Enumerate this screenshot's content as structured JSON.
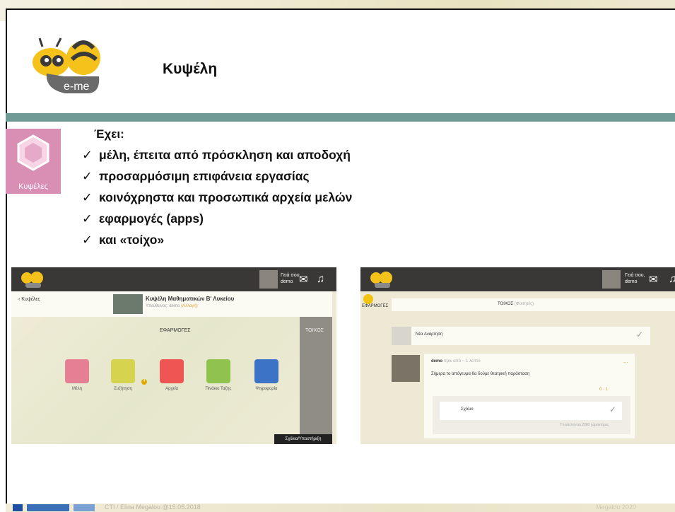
{
  "slide": {
    "title": "Κυψέλη",
    "logo_text": "e-me",
    "tile_label": "Κυψέλες",
    "intro": "Έχει:",
    "check_mark": "✓",
    "bullets": [
      "μέλη, έπειτα από πρόσκληση και αποδοχή",
      "προσαρμόσιμη επιφάνεια εργασίας",
      "κοινόχρηστα και προσωπικά αρχεία μελών",
      "εφαρμογές (apps)",
      "και «τοίχο»"
    ],
    "footer_text": "CTI / Elina Megalou @15.05.2018",
    "footer_right": "Megalou 2020"
  },
  "left_screenshot": {
    "greeting": "Γειά σου,",
    "user": "demo",
    "back_label": "Κυψέλες",
    "hive_title": "Κυψέλη Μαθηματικών Β' Λυκείου",
    "owner_prefix": "Υπεύθυνος:",
    "owner": "demo",
    "owner_suffix": "(Αλλαγή)",
    "apps_header": "ΕΦΑΡΜΟΓΕΣ",
    "wall_header": "ΤΟΙΧΟΣ",
    "apps": [
      {
        "label": "Μέλη",
        "color": "#e57f93",
        "icon": "members-icon"
      },
      {
        "label": "Συζήτηση",
        "color": "#d6d34e",
        "icon": "chat-icon"
      },
      {
        "label": "Αρχεία",
        "color": "#ef5552",
        "icon": "folder-icon"
      },
      {
        "label": "Πινάκιο Ταξης",
        "color": "#8fc34d",
        "icon": "board-icon"
      },
      {
        "label": "Ψηφοφορία",
        "color": "#3d73c7",
        "icon": "poll-icon"
      }
    ],
    "chat_badge": "4",
    "bottom_button": "Σχόλια/Υποστήριξη"
  },
  "right_screenshot": {
    "greeting": "Γειά σου,",
    "user": "demo",
    "left_tab": "ΕΦΑΡΜΟΓΕΣ",
    "wall_header": "ΤΟΙΧΟΣ",
    "wall_sub": "(Φοιτητές)",
    "new_post_placeholder": "Νέα Ανάρτηση",
    "post_author": "demo",
    "post_time": "πριν από ~ 1 λεπτό",
    "post_text": "Σήμερα το απόγευμα θα δούμε θεατρική παράσταση",
    "post_more": "...",
    "likes": "0",
    "stars": "1",
    "comment_placeholder": "Σχόλιο",
    "remaining": "Υπολείπονται 2000 χαρακτήρες"
  }
}
